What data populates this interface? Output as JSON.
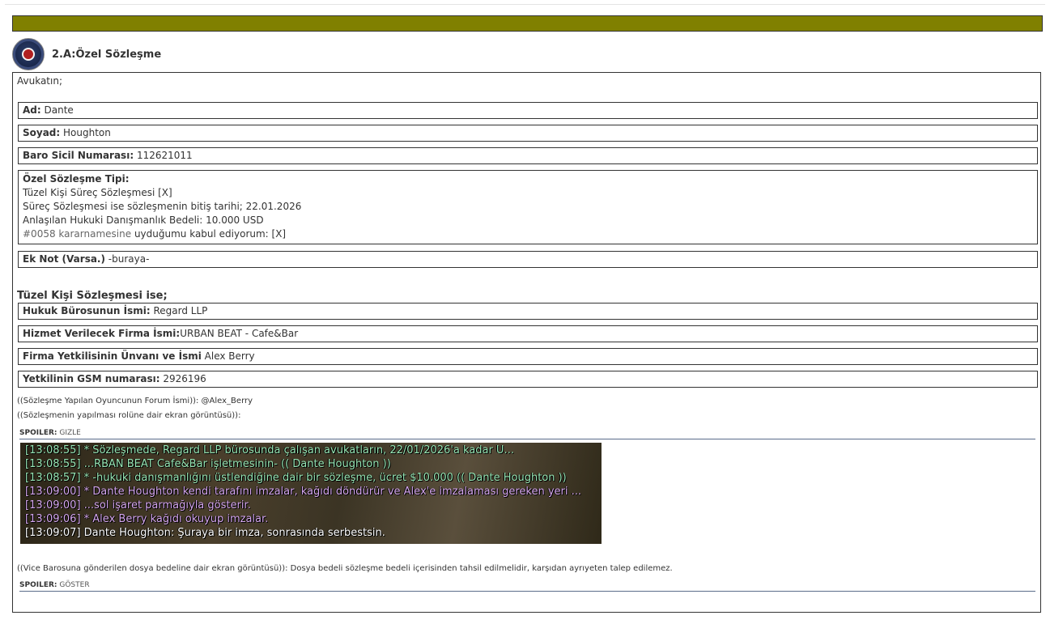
{
  "header": {
    "title": "2.A:Özel Sözleşme",
    "logo_icon": "seal-icon"
  },
  "intro": "Avukatın;",
  "fields": {
    "ad": {
      "label": "Ad:",
      "value": "Dante"
    },
    "soyad": {
      "label": "Soyad:",
      "value": "Houghton"
    },
    "baro": {
      "label": "Baro Sicil Numarası:",
      "value": "112621011"
    },
    "tip": {
      "label": "Özel Sözleşme Tipi:",
      "line1": "Tüzel Kişi Süreç Sözleşmesi [X]",
      "line2": "Süreç Sözleşmesi ise sözleşmenin bitiş tarihi; 22.01.2026",
      "line3": "Anlaşılan Hukuki Danışmanlık Bedeli: 10.000 USD",
      "line4_link": "#0058 kararnamesine",
      "line4_rest": " uyduğumu kabul ediyorum: [X]"
    },
    "ek_not": {
      "label": "Ek Not (Varsa.)",
      "value": " -buraya-"
    }
  },
  "tuzel": {
    "title": "Tüzel Kişi Sözleşmesi ise;",
    "buro": {
      "label": "Hukuk Bürosunun İsmi:",
      "value": "Regard LLP"
    },
    "firma": {
      "label": "Hizmet Verilecek Firma İsmi:",
      "value": "URBAN BEAT - Cafe&Bar"
    },
    "yetkili": {
      "label": "Firma Yetkilisinin Ünvanı ve İsmi",
      "value": "Alex Berry"
    },
    "gsm": {
      "label": "Yetkilinin GSM numarası:",
      "value": "2926196"
    }
  },
  "notes": {
    "forum": "((Sözleşme Yapılan Oyuncunun Forum İsmi)): @Alex_Berry",
    "screenshot": "((Sözleşmenin yapılması rolüne dair ekran görüntüsü)):",
    "vice": "((Vice Barosuna gönderilen dosya bedeline dair ekran görüntüsü)): Dosya bedeli sözleşme bedeli içerisinden tahsil edilmelidir, karşıdan ayrıyeten talep edilemez."
  },
  "spoilers": [
    {
      "label": "SPOILER:",
      "action": "GIZLE"
    },
    {
      "label": "SPOILER:",
      "action": "GÖSTER"
    }
  ],
  "chat_lines": [
    {
      "text": "[13:08:55] * Sözleşmede, Regard LLP bürosunda çalışan avukatların, 22/01/2026'a kadar U...",
      "color": "#97e6b4"
    },
    {
      "text": "[13:08:55] ...RBAN BEAT Cafe&Bar işletmesinin-    (( Dante Houghton ))",
      "color": "#97e6b4"
    },
    {
      "text": "[13:08:57] * -hukuki danışmanlığını üstlendiğine dair bir sözleşme, ücret $10.000 (( Dante Houghton ))",
      "color": "#97e6b4"
    },
    {
      "text": "[13:09:00] * Dante Houghton kendi tarafını imzalar, kağıdı döndürür ve Alex'e imzalaması gereken yeri ...",
      "color": "#d6a7ef"
    },
    {
      "text": "[13:09:00] ...sol işaret parmağıyla gösterir.",
      "color": "#d6a7ef"
    },
    {
      "text": "[13:09:06] * Alex Berry kağıdı okuyup imzalar.",
      "color": "#d6a7ef"
    },
    {
      "text": "[13:09:07] Dante Houghton: Şuraya bir imza, sonrasında serbestsin.",
      "color": "#ffffff"
    }
  ],
  "colors": {
    "olive_bar": "#808000",
    "border": "#333333",
    "spoiler_line": "#5a6c8a"
  }
}
